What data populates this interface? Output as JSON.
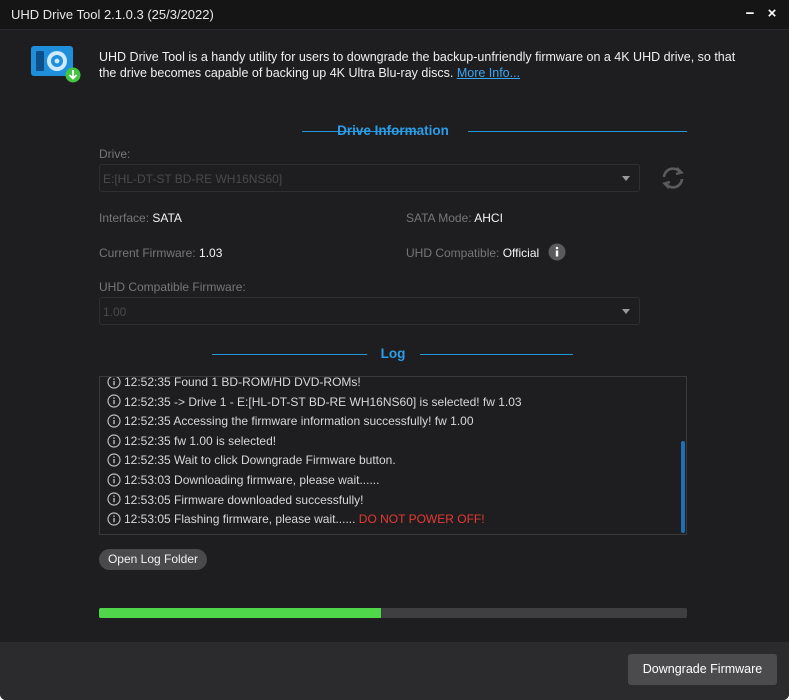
{
  "window": {
    "title": "UHD Drive Tool 2.1.0.3 (25/3/2022)",
    "minimize_symbol": "−",
    "close_symbol": "×"
  },
  "intro": {
    "text": "UHD Drive Tool is a handy utility for users to downgrade the backup-unfriendly firmware on a 4K UHD drive, so that the drive becomes capable of backing up 4K Ultra Blu-ray discs. ",
    "link": "More Info..."
  },
  "drive_info": {
    "heading": "Drive Information",
    "drive_label": "Drive:",
    "drive_value": "E:[HL-DT-ST BD-RE  WH16NS60]",
    "interface_label": "Interface:",
    "interface_value": "SATA",
    "sata_mode_label": "SATA Mode:",
    "sata_mode_value": "AHCI",
    "current_fw_label": "Current Firmware:",
    "current_fw_value": "1.03",
    "uhd_compat_label": "UHD Compatible:",
    "uhd_compat_value": "Official",
    "uhd_fw_label": "UHD Compatible Firmware:",
    "uhd_fw_value": "1.00"
  },
  "log": {
    "heading": "Log",
    "lines": [
      {
        "text": "12:52:35 Found 1 BD-ROM/HD DVD-ROMs!",
        "warn": ""
      },
      {
        "text": "12:52:35 -> Drive 1 - E:[HL-DT-ST BD-RE WH16NS60] is selected! fw 1.03",
        "warn": ""
      },
      {
        "text": "12:52:35 Accessing the firmware information successfully! fw 1.00",
        "warn": ""
      },
      {
        "text": "12:52:35 fw 1.00 is selected!",
        "warn": ""
      },
      {
        "text": "12:52:35 Wait to click Downgrade Firmware button.",
        "warn": ""
      },
      {
        "text": "12:53:03 Downloading firmware, please wait......",
        "warn": ""
      },
      {
        "text": "12:53:05 Firmware downloaded successfully!",
        "warn": ""
      },
      {
        "text": "12:53:05 Flashing firmware, please wait...... ",
        "warn": "DO NOT POWER OFF!"
      }
    ],
    "open_folder_label": "Open Log Folder"
  },
  "progress": {
    "fraction": 0.48
  },
  "footer": {
    "downgrade_label": "Downgrade Firmware"
  },
  "colors": {
    "accent": "#2a9ee8",
    "progress": "#4fd64a",
    "warning": "#e53935",
    "link": "#3aa5f2"
  },
  "icons": {
    "app": "disc-drive-download-icon",
    "refresh": "refresh-icon",
    "info": "info-icon",
    "log_line": "info-circle-icon"
  }
}
